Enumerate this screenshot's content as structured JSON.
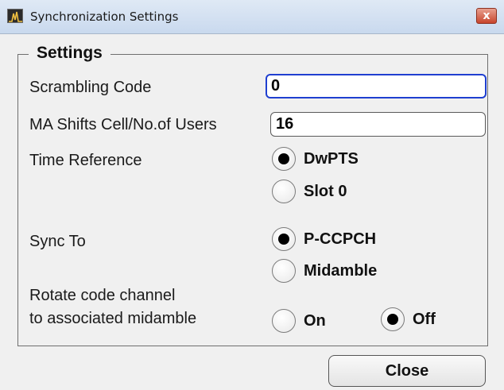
{
  "window": {
    "title": "Synchronization Settings",
    "close_glyph": "x"
  },
  "settings": {
    "group_label": "Settings",
    "scrambling_code": {
      "label": "Scrambling Code",
      "value": "0"
    },
    "ma_shifts": {
      "label": "MA Shifts Cell/No.of Users",
      "value": "16"
    },
    "time_reference": {
      "label": "Time Reference",
      "options": [
        "DwPTS",
        "Slot 0"
      ],
      "selected": "DwPTS"
    },
    "sync_to": {
      "label": "Sync To",
      "options": [
        "P-CCPCH",
        "Midamble"
      ],
      "selected": "P-CCPCH"
    },
    "rotate": {
      "label_line1": "Rotate code channel",
      "label_line2": "to associated midamble",
      "options": [
        "On",
        "Off"
      ],
      "selected": "Off"
    }
  },
  "footer": {
    "close_label": "Close"
  },
  "colors": {
    "focus_border": "#1f3fd0",
    "close_x_bg": "#c8452d"
  },
  "icons": {
    "app": "spectrum-analyzer-icon",
    "close": "close-icon"
  }
}
